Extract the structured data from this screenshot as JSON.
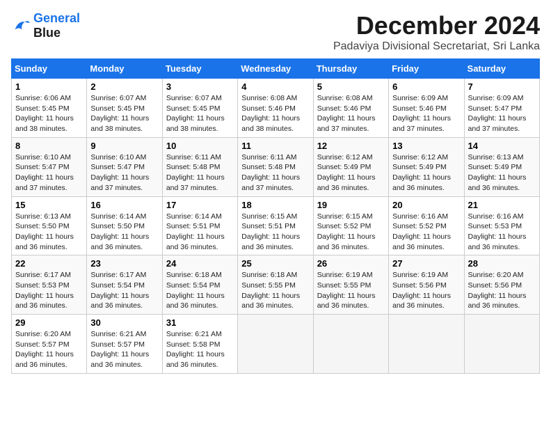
{
  "logo": {
    "line1": "General",
    "line2": "Blue"
  },
  "title": "December 2024",
  "subtitle": "Padaviya Divisional Secretariat, Sri Lanka",
  "weekdays": [
    "Sunday",
    "Monday",
    "Tuesday",
    "Wednesday",
    "Thursday",
    "Friday",
    "Saturday"
  ],
  "weeks": [
    [
      {
        "day": "1",
        "info": "Sunrise: 6:06 AM\nSunset: 5:45 PM\nDaylight: 11 hours\nand 38 minutes."
      },
      {
        "day": "2",
        "info": "Sunrise: 6:07 AM\nSunset: 5:45 PM\nDaylight: 11 hours\nand 38 minutes."
      },
      {
        "day": "3",
        "info": "Sunrise: 6:07 AM\nSunset: 5:45 PM\nDaylight: 11 hours\nand 38 minutes."
      },
      {
        "day": "4",
        "info": "Sunrise: 6:08 AM\nSunset: 5:46 PM\nDaylight: 11 hours\nand 38 minutes."
      },
      {
        "day": "5",
        "info": "Sunrise: 6:08 AM\nSunset: 5:46 PM\nDaylight: 11 hours\nand 37 minutes."
      },
      {
        "day": "6",
        "info": "Sunrise: 6:09 AM\nSunset: 5:46 PM\nDaylight: 11 hours\nand 37 minutes."
      },
      {
        "day": "7",
        "info": "Sunrise: 6:09 AM\nSunset: 5:47 PM\nDaylight: 11 hours\nand 37 minutes."
      }
    ],
    [
      {
        "day": "8",
        "info": "Sunrise: 6:10 AM\nSunset: 5:47 PM\nDaylight: 11 hours\nand 37 minutes."
      },
      {
        "day": "9",
        "info": "Sunrise: 6:10 AM\nSunset: 5:47 PM\nDaylight: 11 hours\nand 37 minutes."
      },
      {
        "day": "10",
        "info": "Sunrise: 6:11 AM\nSunset: 5:48 PM\nDaylight: 11 hours\nand 37 minutes."
      },
      {
        "day": "11",
        "info": "Sunrise: 6:11 AM\nSunset: 5:48 PM\nDaylight: 11 hours\nand 37 minutes."
      },
      {
        "day": "12",
        "info": "Sunrise: 6:12 AM\nSunset: 5:49 PM\nDaylight: 11 hours\nand 36 minutes."
      },
      {
        "day": "13",
        "info": "Sunrise: 6:12 AM\nSunset: 5:49 PM\nDaylight: 11 hours\nand 36 minutes."
      },
      {
        "day": "14",
        "info": "Sunrise: 6:13 AM\nSunset: 5:49 PM\nDaylight: 11 hours\nand 36 minutes."
      }
    ],
    [
      {
        "day": "15",
        "info": "Sunrise: 6:13 AM\nSunset: 5:50 PM\nDaylight: 11 hours\nand 36 minutes."
      },
      {
        "day": "16",
        "info": "Sunrise: 6:14 AM\nSunset: 5:50 PM\nDaylight: 11 hours\nand 36 minutes."
      },
      {
        "day": "17",
        "info": "Sunrise: 6:14 AM\nSunset: 5:51 PM\nDaylight: 11 hours\nand 36 minutes."
      },
      {
        "day": "18",
        "info": "Sunrise: 6:15 AM\nSunset: 5:51 PM\nDaylight: 11 hours\nand 36 minutes."
      },
      {
        "day": "19",
        "info": "Sunrise: 6:15 AM\nSunset: 5:52 PM\nDaylight: 11 hours\nand 36 minutes."
      },
      {
        "day": "20",
        "info": "Sunrise: 6:16 AM\nSunset: 5:52 PM\nDaylight: 11 hours\nand 36 minutes."
      },
      {
        "day": "21",
        "info": "Sunrise: 6:16 AM\nSunset: 5:53 PM\nDaylight: 11 hours\nand 36 minutes."
      }
    ],
    [
      {
        "day": "22",
        "info": "Sunrise: 6:17 AM\nSunset: 5:53 PM\nDaylight: 11 hours\nand 36 minutes."
      },
      {
        "day": "23",
        "info": "Sunrise: 6:17 AM\nSunset: 5:54 PM\nDaylight: 11 hours\nand 36 minutes."
      },
      {
        "day": "24",
        "info": "Sunrise: 6:18 AM\nSunset: 5:54 PM\nDaylight: 11 hours\nand 36 minutes."
      },
      {
        "day": "25",
        "info": "Sunrise: 6:18 AM\nSunset: 5:55 PM\nDaylight: 11 hours\nand 36 minutes."
      },
      {
        "day": "26",
        "info": "Sunrise: 6:19 AM\nSunset: 5:55 PM\nDaylight: 11 hours\nand 36 minutes."
      },
      {
        "day": "27",
        "info": "Sunrise: 6:19 AM\nSunset: 5:56 PM\nDaylight: 11 hours\nand 36 minutes."
      },
      {
        "day": "28",
        "info": "Sunrise: 6:20 AM\nSunset: 5:56 PM\nDaylight: 11 hours\nand 36 minutes."
      }
    ],
    [
      {
        "day": "29",
        "info": "Sunrise: 6:20 AM\nSunset: 5:57 PM\nDaylight: 11 hours\nand 36 minutes."
      },
      {
        "day": "30",
        "info": "Sunrise: 6:21 AM\nSunset: 5:57 PM\nDaylight: 11 hours\nand 36 minutes."
      },
      {
        "day": "31",
        "info": "Sunrise: 6:21 AM\nSunset: 5:58 PM\nDaylight: 11 hours\nand 36 minutes."
      },
      {
        "day": "",
        "info": ""
      },
      {
        "day": "",
        "info": ""
      },
      {
        "day": "",
        "info": ""
      },
      {
        "day": "",
        "info": ""
      }
    ]
  ]
}
